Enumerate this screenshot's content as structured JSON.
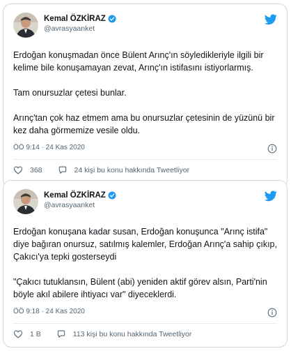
{
  "tweets": [
    {
      "author": {
        "name": "Kemal ÖZKİRAZ",
        "handle": "@avrasyaanket"
      },
      "paragraphs": [
        "Erdoğan konuşmadan önce Bülent Arınç'ın söyledikleriyle ilgili bir kelime bile konuşamayan zevat, Arınç'ın istifasını istiyorlarmış.",
        "Tam onursuzlar çetesi bunlar.",
        "Arınç'tan çok haz etmem ama bu onursuzlar çetesinin de yüzünü bir kez daha görmemize vesile oldu."
      ],
      "timestamp": "ÖÖ 9:14 · 24 Kas 2020",
      "likes": "368",
      "talking": "24 kişi bu konu hakkında Tweetliyor"
    },
    {
      "author": {
        "name": "Kemal ÖZKİRAZ",
        "handle": "@avrasyaanket"
      },
      "paragraphs": [
        "Erdoğan konuşana kadar susan, Erdoğan konuşunca \"Arınç istifa\" diye bağıran onursuz, satılmış kalemler, Erdoğan Arınç'a sahip çıkıp, Çakıcı'ya tepki gosterseydi",
        "\"Çakıcı tutuklansın, Bülent (abi) yeniden aktif görev alsın, Parti'nin böyle akıl abilere ihtiyacı var\" diyeceklerdi."
      ],
      "timestamp": "ÖÖ 9:18 · 24 Kas 2020",
      "likes": "1 B",
      "talking": "113 kişi bu konu hakkında Tweetliyor"
    }
  ],
  "icons": {
    "bird": "twitter-bird-icon",
    "verified": "verified-badge-icon",
    "info": "info-icon",
    "like": "heart-icon",
    "reply": "speech-bubble-icon"
  },
  "colors": {
    "brand": "#1d9bf0",
    "text": "#0f1419",
    "muted": "#536471",
    "like": "#e0245e"
  }
}
